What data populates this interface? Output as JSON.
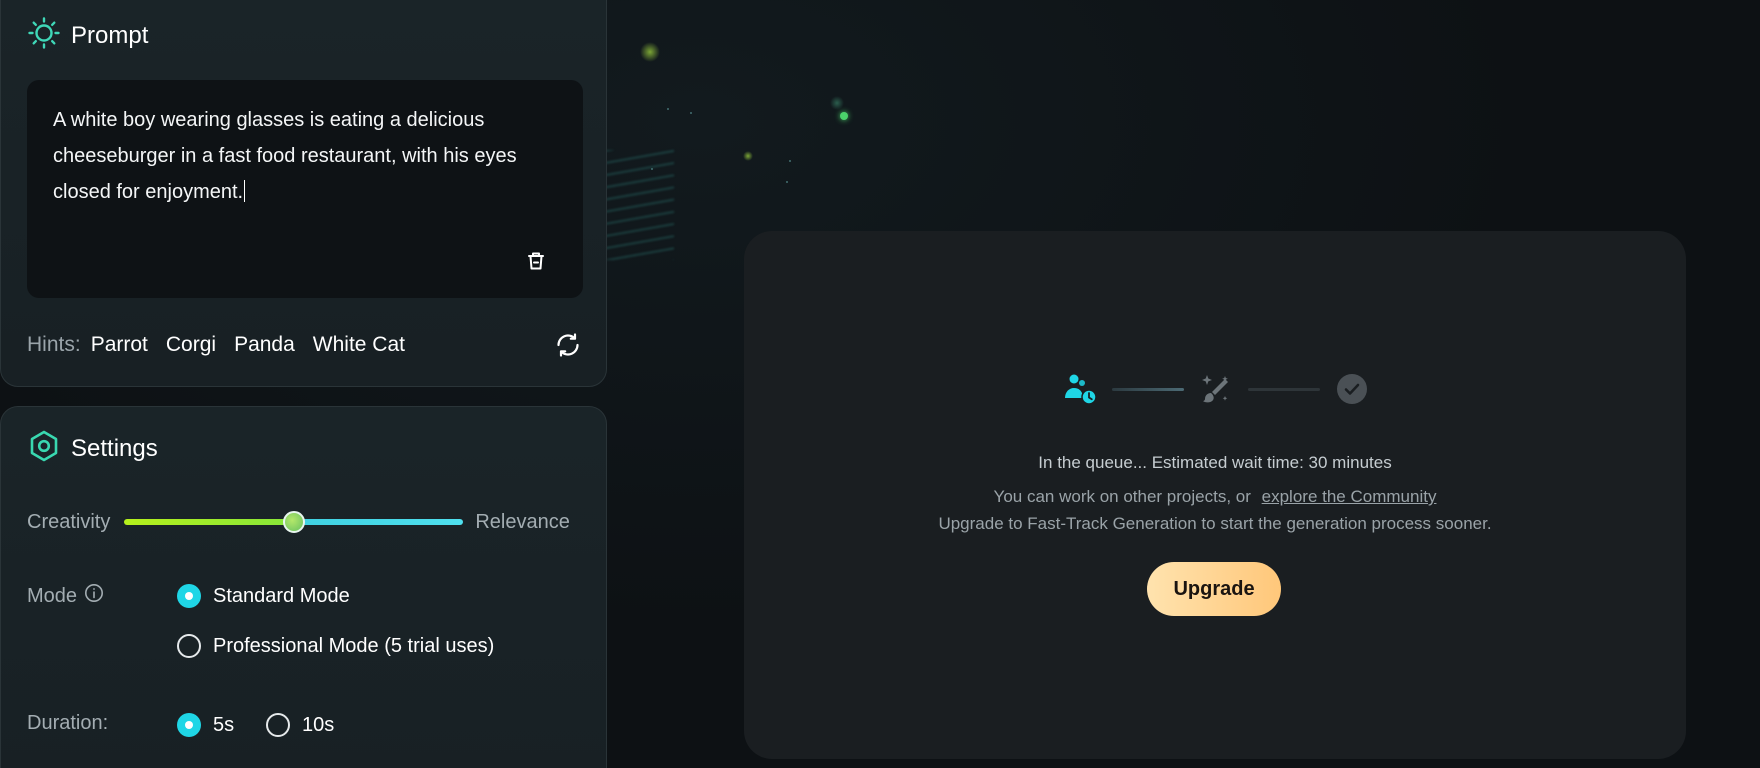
{
  "prompt_panel": {
    "title": "Prompt",
    "text": " A white boy wearing glasses is eating a delicious cheeseburger in a fast food restaurant, with his eyes closed for enjoyment.",
    "hints_label": "Hints:",
    "hints": [
      "Parrot",
      "Corgi",
      "Panda",
      "White Cat"
    ]
  },
  "settings_panel": {
    "title": "Settings",
    "slider": {
      "left_label": "Creativity",
      "right_label": "Relevance",
      "value": 0.5
    },
    "mode": {
      "label": "Mode",
      "options": [
        {
          "label": "Standard Mode",
          "selected": true
        },
        {
          "label": "Professional Mode (5 trial uses)",
          "selected": false
        }
      ]
    },
    "duration": {
      "label": "Duration:",
      "options": [
        {
          "label": "5s",
          "selected": true
        },
        {
          "label": "10s",
          "selected": false
        }
      ]
    }
  },
  "queue": {
    "status": "In the queue... Estimated wait time: 30 minutes",
    "line2_prefix": "You can work on other projects, or",
    "community_link": "explore the Community",
    "line3": "Upgrade to Fast-Track Generation to start the generation process sooner.",
    "upgrade_label": "Upgrade"
  },
  "colors": {
    "accent_cyan": "#1fd6e6",
    "accent_green": "#b6f01c",
    "upgrade_gradient_start": "#ffe3ae",
    "upgrade_gradient_end": "#ffc77a"
  },
  "icons": {
    "prompt": "sun-icon",
    "settings": "hexagon-icon",
    "clear": "trash-icon",
    "refresh": "refresh-icon",
    "mode_info": "info-icon",
    "step_queue": "users-clock-icon",
    "step_generate": "magic-brush-icon",
    "step_done": "check-circle-icon"
  }
}
